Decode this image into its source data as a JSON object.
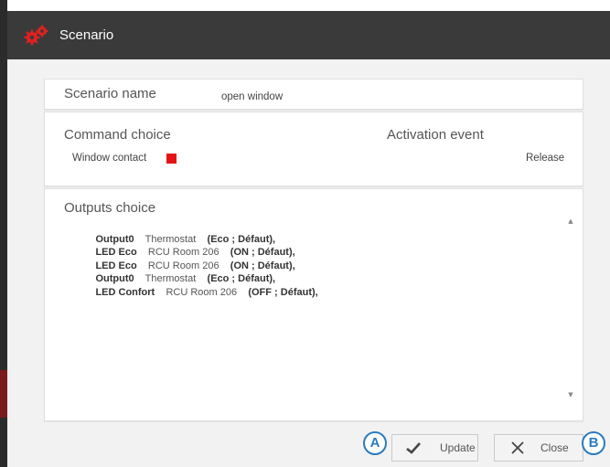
{
  "window": {
    "title": "Scenario",
    "icon": "gears-icon"
  },
  "scenario_name": {
    "label": "Scenario name",
    "value": "open window"
  },
  "command": {
    "label": "Command choice",
    "item": "Window contact",
    "indicator_color": "#e51414"
  },
  "activation": {
    "label": "Activation event",
    "value": "Release"
  },
  "outputs": {
    "label": "Outputs choice",
    "rows": [
      {
        "name": "Output0",
        "room": "Thermostat",
        "state": "(Eco ; Défaut),"
      },
      {
        "name": "LED Eco",
        "room": "RCU Room 206",
        "state": "(ON ; Défaut),"
      },
      {
        "name": "LED Eco",
        "room": "RCU Room 206",
        "state": "(ON ; Défaut),"
      },
      {
        "name": "Output0",
        "room": "Thermostat",
        "state": "(Eco ; Défaut),"
      },
      {
        "name": "LED Confort",
        "room": "RCU Room 206",
        "state": "(OFF ; Défaut),"
      }
    ]
  },
  "buttons": {
    "update": "Update",
    "close": "Close"
  },
  "callouts": {
    "a": "A",
    "b": "B"
  },
  "colors": {
    "titlebar": "#3a3a3a",
    "accent": "#2a7bbf",
    "indicator": "#e51414"
  }
}
